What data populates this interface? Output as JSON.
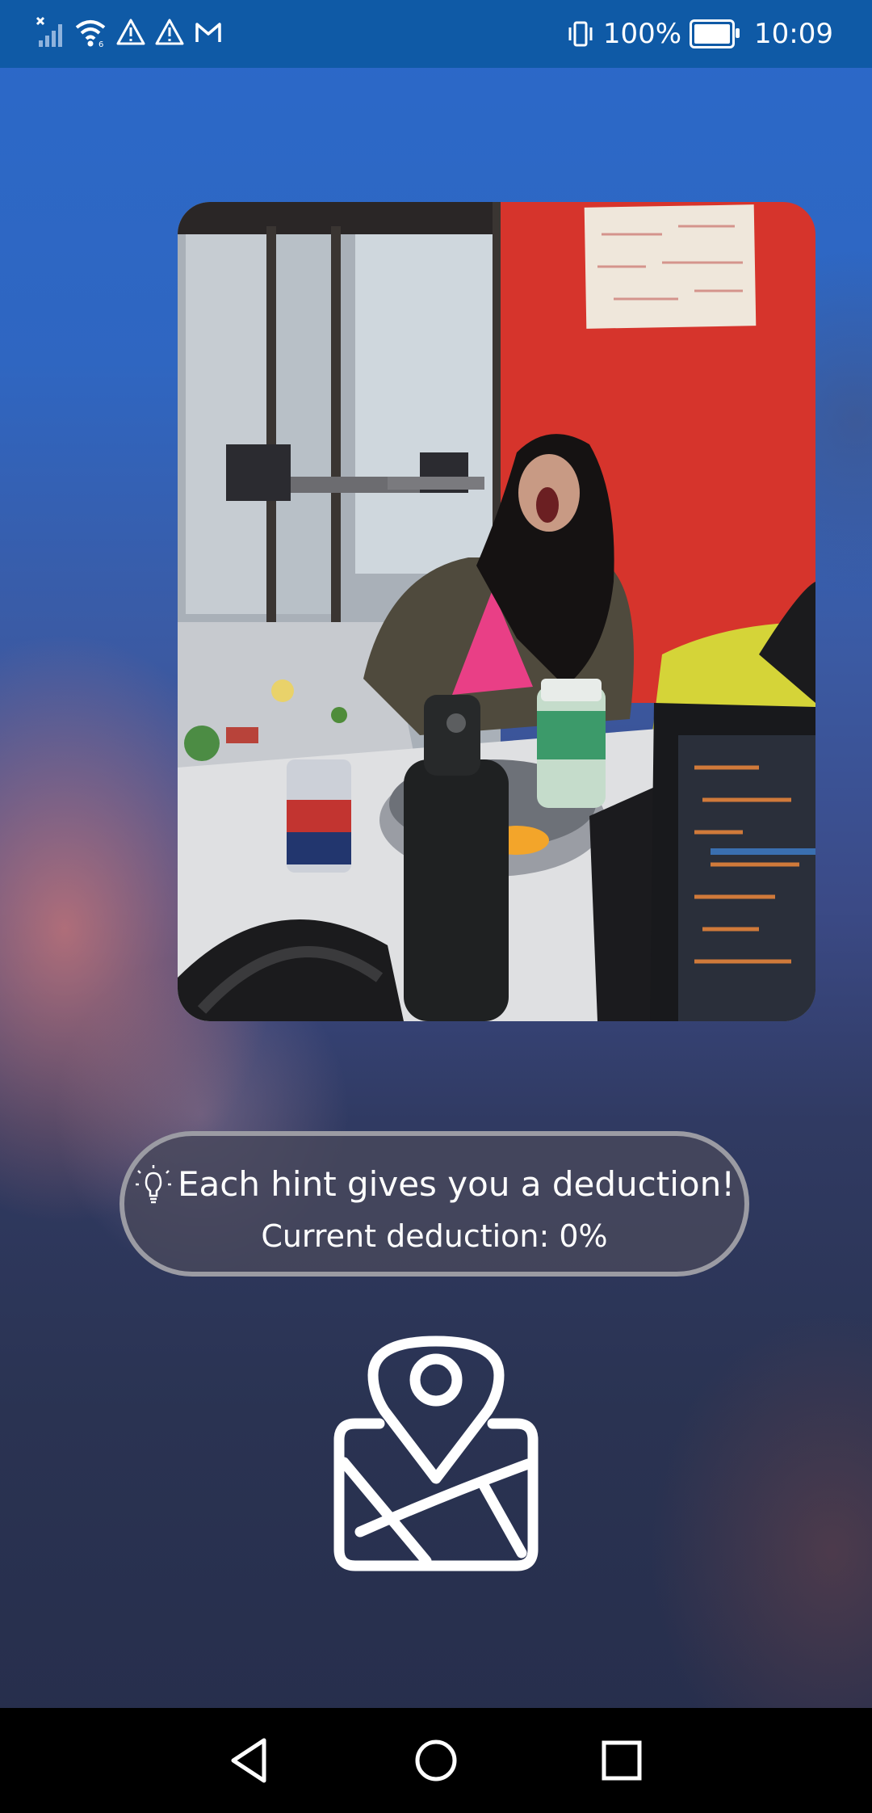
{
  "status_bar": {
    "left_icons": [
      "no-signal-icon",
      "wifi-icon",
      "warning-icon",
      "warning-icon",
      "gmail-icon"
    ],
    "vibrate_icon": "vibrate-icon",
    "battery_percent": "100%",
    "battery_icon": "battery-charging-icon",
    "time": "10:09"
  },
  "photo": {
    "icon": "hint-photo"
  },
  "hint": {
    "icon": "lightbulb-icon",
    "message": "Each hint gives you a deduction!",
    "deduction_text": "Current deduction: 0%"
  },
  "map_button": {
    "icon": "map-pin-icon"
  },
  "nav_bar": {
    "back_icon": "back-triangle-icon",
    "home_icon": "home-circle-icon",
    "recents_icon": "recents-square-icon"
  },
  "colors": {
    "status_bar": "#0f5aa6",
    "pill_border": "#9b9ba3",
    "wall_red": "#d6342c"
  }
}
